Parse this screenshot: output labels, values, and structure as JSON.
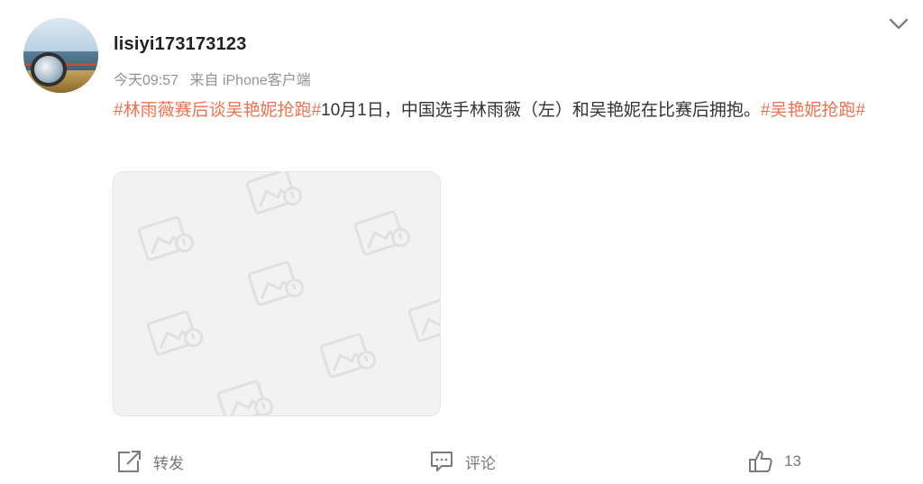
{
  "post": {
    "username": "lisiyi173173123",
    "time": "今天09:57",
    "source": "来自 iPhone客户端",
    "content": {
      "topic1": "#林雨薇赛后谈吴艳妮抢跑#",
      "text": "10月1日，中国选手林雨薇（左）和吴艳妮在比赛后拥抱。",
      "topic2": "#吴艳妮抢跑#"
    }
  },
  "actions": {
    "repost_label": "转发",
    "comment_label": "评论",
    "like_count": "13"
  },
  "icons": {
    "menu": "chevron-down-icon",
    "repost": "share-icon",
    "comment": "comment-icon",
    "like": "thumbs-up-icon",
    "image_placeholder": "image-placeholder-icon"
  },
  "colors": {
    "topic": "#eb7350",
    "username": "#222222",
    "meta": "#939393",
    "action": "#777777"
  }
}
